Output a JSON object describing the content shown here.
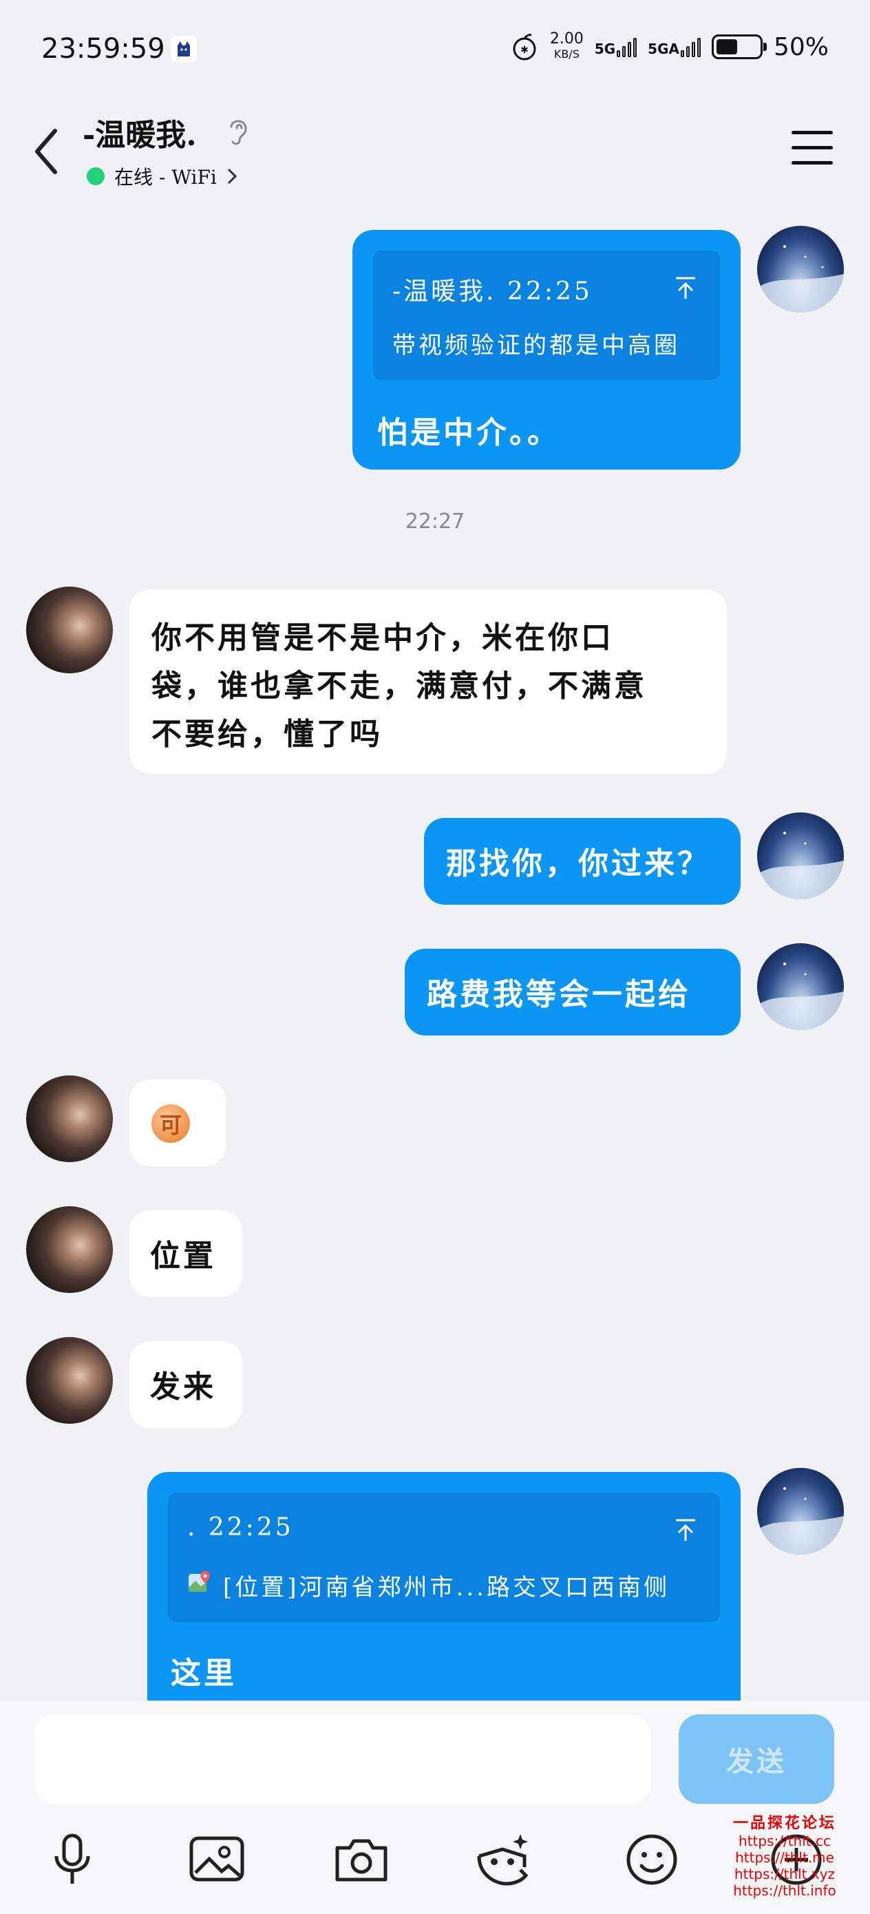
{
  "status_bar": {
    "time": "23:59:59",
    "net_speed_value": "2.00",
    "net_speed_unit": "KB/S",
    "sim1": "5G",
    "sim2": "5GA",
    "battery": "50%",
    "battery_level": 0.5
  },
  "header": {
    "contact_name": "-温暖我.",
    "status": "在线 - WiFi",
    "status_color": "#22d17a"
  },
  "messages": [
    {
      "side": "me",
      "quote_meta": "-温暖我. 22:25",
      "quote_text": "带视频验证的都是中高圈",
      "text": "怕是中介。。"
    },
    {
      "side": "them",
      "lines": [
        "你不用管是不是中介，米在你口",
        "袋，谁也拿不走，满意付，不满意",
        "不要给，懂了吗"
      ]
    },
    {
      "side": "me",
      "text": "那找你，你过来？"
    },
    {
      "side": "me",
      "text": "路费我等会一起给"
    },
    {
      "side": "them",
      "emoji": "可"
    },
    {
      "side": "them",
      "text": "位置"
    },
    {
      "side": "them",
      "text": "发来"
    },
    {
      "side": "me",
      "quote_meta": ". 22:25",
      "quote_text": "[位置]河南省郑州市...路交叉口西南侧",
      "text": "这里"
    }
  ],
  "timestamp": "22:27",
  "input": {
    "placeholder": "",
    "send_label": "发送"
  },
  "toolbar": [
    "mic-icon",
    "image-icon",
    "camera-icon",
    "sticker-icon",
    "emoji-icon",
    "plus-icon"
  ],
  "watermark": {
    "title": "一品探花论坛",
    "urls": [
      "https://thlt.cc",
      "https://thlt.me",
      "https://thlt.xyz",
      "https://thlt.info"
    ]
  },
  "colors": {
    "my_bubble": "#0b96f5",
    "quote_bg": "#0a83e0",
    "send_disabled": "#7ec3f6",
    "background": "#f0f1f5"
  }
}
